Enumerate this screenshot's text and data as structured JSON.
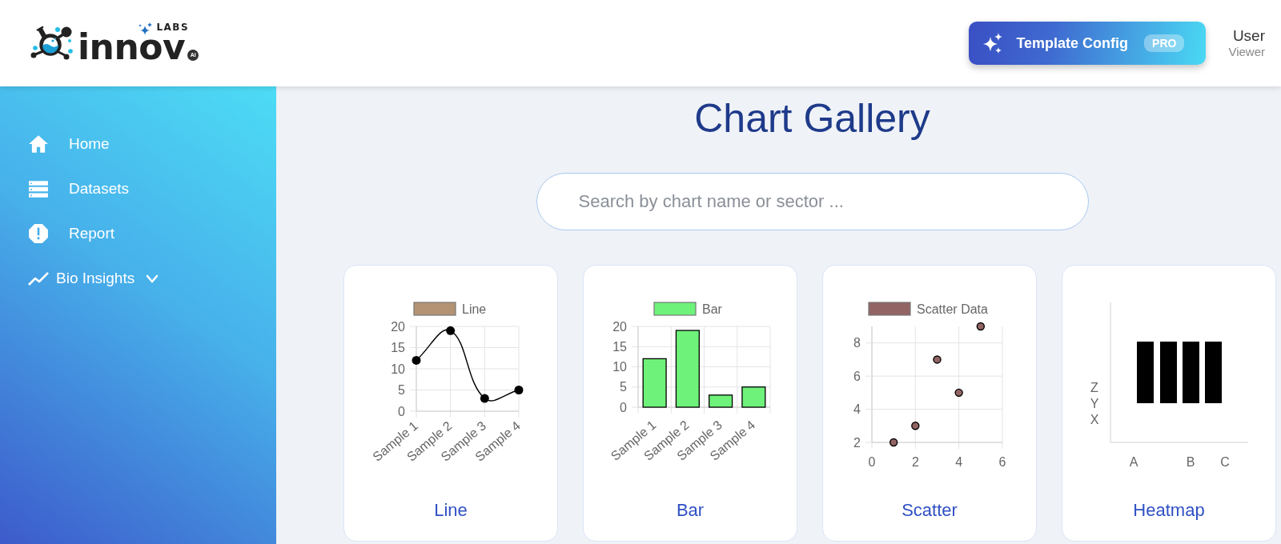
{
  "header": {
    "logo": {
      "wordmark": "innov",
      "tag": "LABS",
      "badge": "AI"
    },
    "pro_button": {
      "label": "Template Config",
      "badge": "PRO"
    },
    "user": {
      "name": "User",
      "role": "Viewer"
    }
  },
  "sidebar": {
    "items": [
      {
        "label": "Home",
        "kind": "link"
      },
      {
        "label": "Datasets",
        "kind": "link"
      },
      {
        "label": "Report",
        "kind": "link"
      },
      {
        "label": "Bio Insights",
        "kind": "group",
        "expanded": false
      }
    ]
  },
  "main": {
    "title": "Chart Gallery",
    "search": {
      "placeholder": "Search by chart name or sector ..."
    },
    "cards": [
      {
        "title": "Line",
        "legend_swatch": {
          "color": "#b39373"
        },
        "chart_data": {
          "type": "line",
          "categories": [
            "Sample 1",
            "Sample 2",
            "Sample 3",
            "Sample 4"
          ],
          "series": [
            {
              "name": "Line",
              "color": "#000000",
              "marker": "circle",
              "values": [
                12,
                19,
                3,
                5
              ]
            }
          ],
          "ylim": [
            0,
            20
          ],
          "yticks": [
            0,
            5,
            10,
            15,
            20
          ],
          "grid": true
        }
      },
      {
        "title": "Bar",
        "chart_data": {
          "type": "bar",
          "categories": [
            "Sample 1",
            "Sample 2",
            "Sample 3",
            "Sample 4"
          ],
          "series": [
            {
              "name": "Bar",
              "color": "#6ef27a",
              "values": [
                12,
                19,
                3,
                5
              ]
            }
          ],
          "ylim": [
            0,
            20
          ],
          "yticks": [
            0,
            5,
            10,
            15,
            20
          ],
          "grid": true
        }
      },
      {
        "title": "Scatter",
        "chart_data": {
          "type": "scatter",
          "x": [
            1,
            2,
            3,
            4,
            5
          ],
          "series": [
            {
              "name": "Scatter Data",
              "color": "#936464",
              "values": [
                2,
                3,
                7,
                5,
                9
              ]
            }
          ],
          "xlim": [
            0,
            6
          ],
          "ylim": [
            2,
            9
          ],
          "xticks": [
            0,
            2,
            4,
            6
          ],
          "yticks": [
            2,
            4,
            6,
            8
          ],
          "grid": true
        }
      },
      {
        "title": "Heatmap",
        "heatmap": {
          "x_labels": [
            "A",
            "B",
            "C"
          ],
          "y_labels": [
            "Z",
            "Y",
            "X"
          ]
        }
      }
    ]
  }
}
